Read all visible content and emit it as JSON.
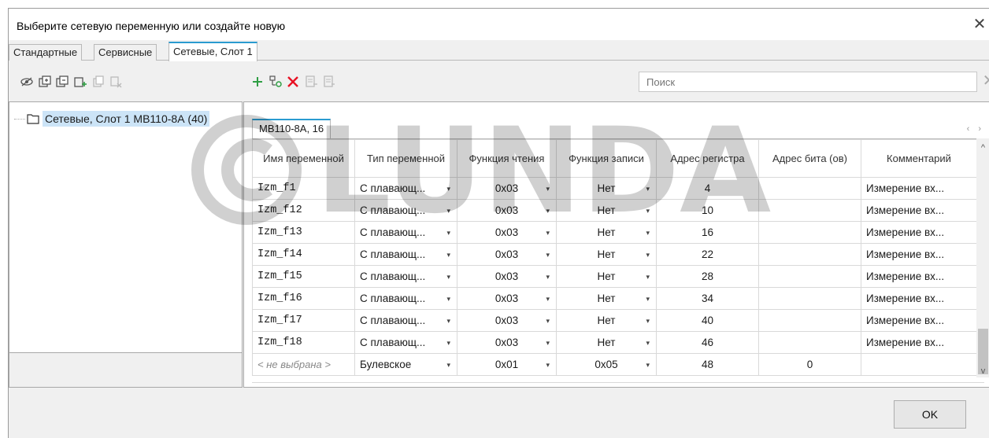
{
  "window": {
    "title": "Выберите сетевую переменную или создайте новую"
  },
  "tabs": [
    {
      "label": "Стандартные",
      "active": false
    },
    {
      "label": "Сервисные",
      "active": false
    },
    {
      "label": "Сетевые, Слот 1",
      "active": true
    }
  ],
  "toolbar_left": [
    "visibility-icon",
    "expand-all-icon",
    "collapse-all-icon",
    "add-node-icon",
    "copy-icon",
    "delete-node-icon"
  ],
  "toolbar_right": [
    "add-icon",
    "link-variable-icon",
    "delete-icon",
    "export-icon",
    "import-icon"
  ],
  "search": {
    "placeholder": "Поиск"
  },
  "tree": {
    "items": [
      {
        "label": "Сетевые, Слот 1 МВ110-8А (40)",
        "selected": true
      }
    ]
  },
  "subtab": {
    "label": "МВ110-8А, 16"
  },
  "grid": {
    "columns": [
      "Имя переменной",
      "Тип переменной",
      "Функция чтения",
      "Функция записи",
      "Адрес регистра",
      "Адрес бита (ов)",
      "Комментарий"
    ],
    "rows": [
      {
        "name": "Izm_f1",
        "type": "С плавающ...",
        "read": "0x03",
        "write": "Нет",
        "reg": "4",
        "bit": "",
        "comment": "Измерение вх..."
      },
      {
        "name": "Izm_f12",
        "type": "С плавающ...",
        "read": "0x03",
        "write": "Нет",
        "reg": "10",
        "bit": "",
        "comment": "Измерение вх..."
      },
      {
        "name": "Izm_f13",
        "type": "С плавающ...",
        "read": "0x03",
        "write": "Нет",
        "reg": "16",
        "bit": "",
        "comment": "Измерение вх..."
      },
      {
        "name": "Izm_f14",
        "type": "С плавающ...",
        "read": "0x03",
        "write": "Нет",
        "reg": "22",
        "bit": "",
        "comment": "Измерение вх..."
      },
      {
        "name": "Izm_f15",
        "type": "С плавающ...",
        "read": "0x03",
        "write": "Нет",
        "reg": "28",
        "bit": "",
        "comment": "Измерение вх..."
      },
      {
        "name": "Izm_f16",
        "type": "С плавающ...",
        "read": "0x03",
        "write": "Нет",
        "reg": "34",
        "bit": "",
        "comment": "Измерение вх..."
      },
      {
        "name": "Izm_f17",
        "type": "С плавающ...",
        "read": "0x03",
        "write": "Нет",
        "reg": "40",
        "bit": "",
        "comment": "Измерение вх..."
      },
      {
        "name": "Izm_f18",
        "type": "С плавающ...",
        "read": "0x03",
        "write": "Нет",
        "reg": "46",
        "bit": "",
        "comment": "Измерение вх..."
      },
      {
        "name": "< не выбрана >",
        "type": "Булевское",
        "read": "0x01",
        "write": "0x05",
        "reg": "48",
        "bit": "0",
        "comment": "",
        "placeholder": true
      }
    ]
  },
  "buttons": {
    "ok": "OK"
  },
  "watermark": {
    "text": "©LUNDA"
  },
  "colors": {
    "accent": "#2a9bd0",
    "selection": "#cce4f7",
    "delete": "#e81123",
    "add": "#2f9e44"
  }
}
